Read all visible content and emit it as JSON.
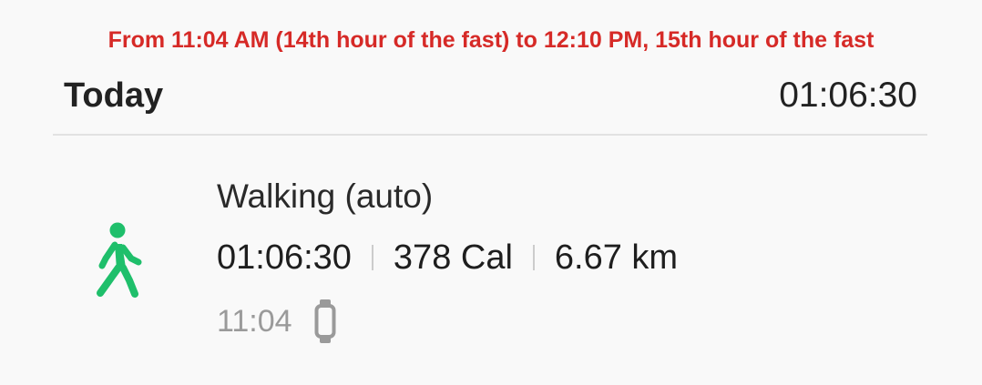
{
  "annotation": "From 11:04 AM (14th hour of the fast) to 12:10 PM, 15th hour of the fast",
  "header": {
    "title": "Today",
    "total_duration": "01:06:30"
  },
  "activity": {
    "icon": "walking-person-icon",
    "icon_color": "#1fbf6b",
    "title": "Walking (auto)",
    "duration": "01:06:30",
    "calories": "378 Cal",
    "distance": "6.67 km",
    "start_time": "11:04",
    "source_icon": "smartwatch-icon"
  }
}
